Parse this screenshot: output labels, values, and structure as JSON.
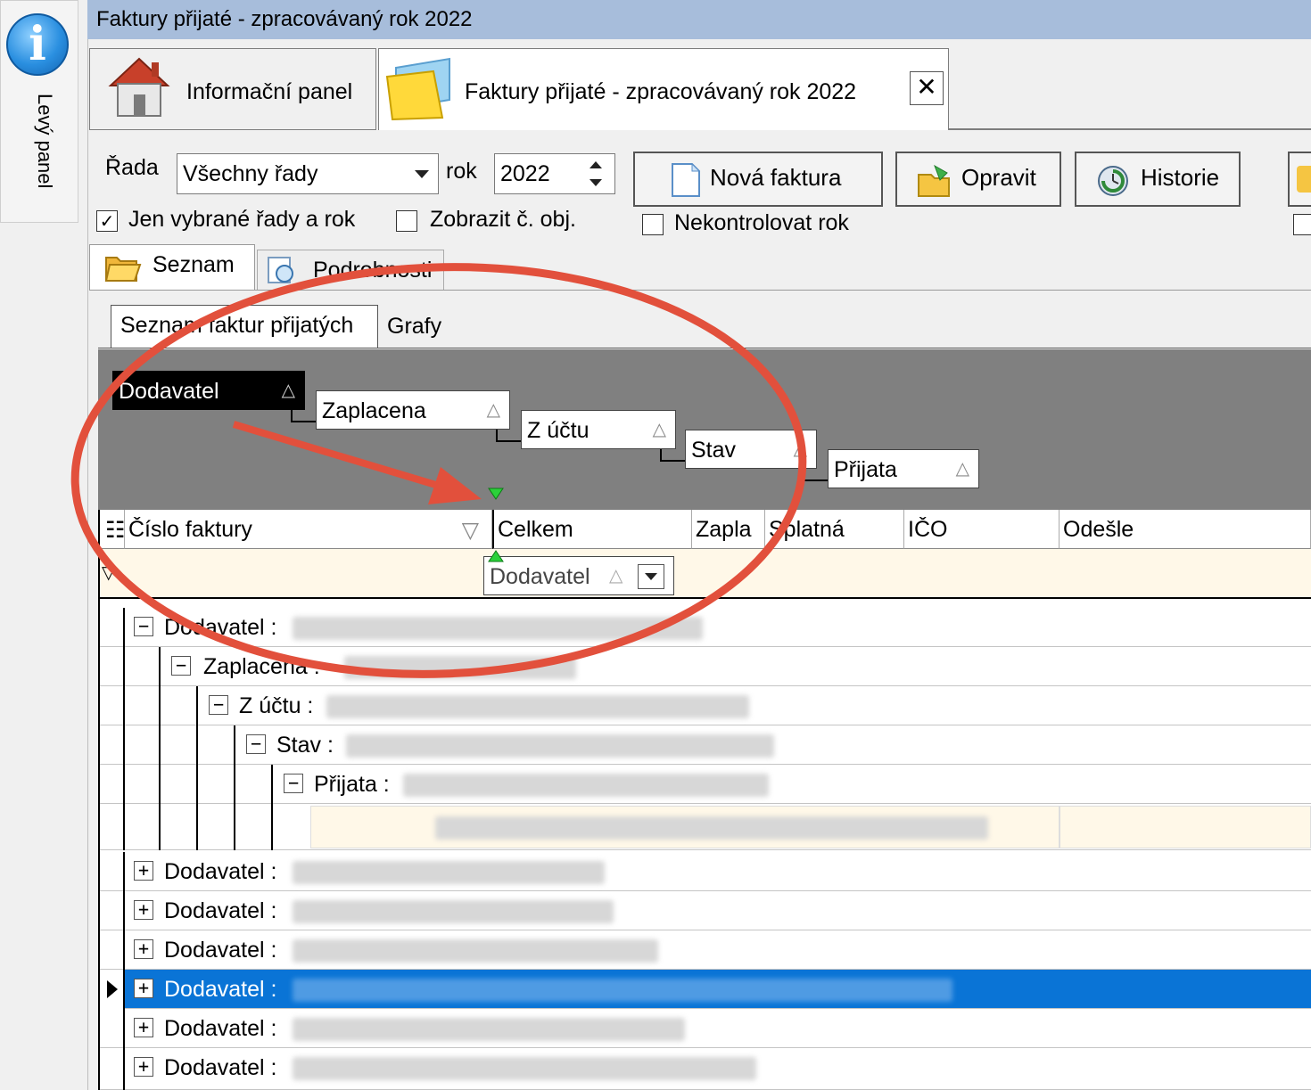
{
  "side_panel": {
    "label": "Levý panel"
  },
  "window": {
    "title": "Faktury přijaté - zpracovávaný rok 2022"
  },
  "doc_tabs": {
    "info": "Informační panel",
    "invoices": "Faktury přijaté - zpracovávaný rok 2022",
    "close": "✕"
  },
  "filters": {
    "rada_label": "Řada",
    "rada_value": "Všechny řady",
    "rok_label": "rok",
    "rok_value": "2022",
    "only_selected": "Jen vybrané řady a rok",
    "show_order": "Zobrazit č. obj.",
    "no_check_year": "Nekontrolovat rok"
  },
  "buttons": {
    "new_invoice": "Nová faktura",
    "edit": "Opravit",
    "history": "Historie"
  },
  "view_tabs": {
    "list": "Seznam",
    "details": "Podrobnosti"
  },
  "inner_tabs": {
    "list": "Seznam faktur přijatých",
    "charts": "Grafy"
  },
  "group_by": [
    "Dodavatel",
    "Zaplacena",
    "Z účtu",
    "Stav",
    "Přijata"
  ],
  "columns": [
    "Číslo faktury",
    "Celkem",
    "Zapla",
    "Splatná",
    "IČO",
    "Odešle"
  ],
  "drag_chip": "Dodavatel",
  "tree_rows": [
    {
      "label": "Dodavatel :",
      "sign": "−"
    },
    {
      "label": "Zaplacena :",
      "sign": "−"
    },
    {
      "label": "Z účtu :",
      "sign": "−"
    },
    {
      "label": "Stav :",
      "sign": "−"
    },
    {
      "label": "Přijata :",
      "sign": "−"
    },
    {
      "label": "Dodavatel :",
      "sign": "+"
    },
    {
      "label": "Dodavatel :",
      "sign": "+"
    },
    {
      "label": "Dodavatel :",
      "sign": "+"
    },
    {
      "label": "Dodavatel :",
      "sign": "+"
    },
    {
      "label": "Dodavatel :",
      "sign": "+"
    },
    {
      "label": "Dodavatel :",
      "sign": "+"
    }
  ],
  "colors": {
    "title_bar": "#a7bddb",
    "selection": "#0a74d6",
    "annotation": "#e2503c"
  }
}
